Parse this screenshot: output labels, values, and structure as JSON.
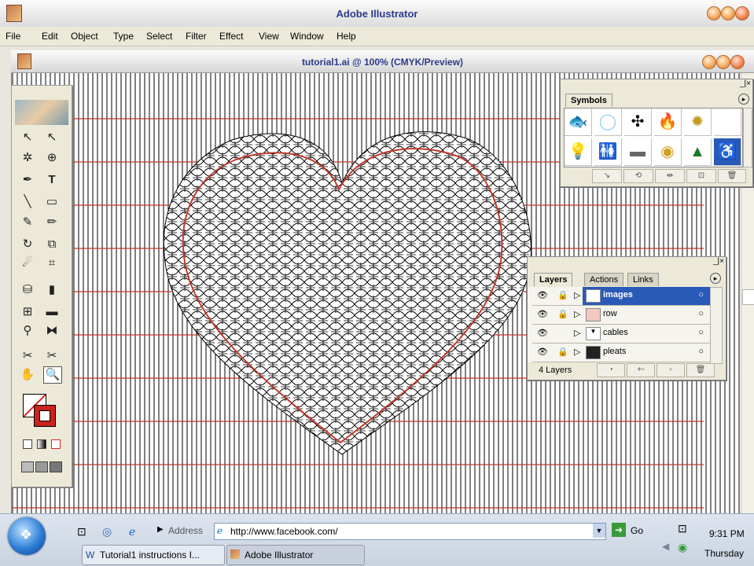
{
  "app": {
    "title": "Adobe Illustrator"
  },
  "menu": [
    "File",
    "Edit",
    "Object",
    "Type",
    "Select",
    "Filter",
    "Effect",
    "View",
    "Window",
    "Help"
  ],
  "document": {
    "title": "tutorial1.ai @ 100% (CMYK/Preview)"
  },
  "symbols_panel": {
    "tab": "Symbols",
    "symbols": [
      "fish",
      "bubble",
      "grime",
      "fire",
      "gear",
      "blank",
      "lightbulb",
      "restrooms",
      "puddle",
      "lantern",
      "tree",
      "wheelchair"
    ]
  },
  "layers_panel": {
    "tabs": [
      "Layers",
      "Actions",
      "Links"
    ],
    "layers": [
      {
        "name": "images",
        "selected": true
      },
      {
        "name": "row",
        "selected": false
      },
      {
        "name": "cables",
        "selected": false
      },
      {
        "name": "pleats",
        "selected": false
      }
    ],
    "count_label": "4 Layers"
  },
  "taskbar": {
    "address_label": "Address",
    "address_value": "http://www.facebook.com/",
    "go_label": "Go",
    "time": "9:31 PM",
    "day": "Thursday",
    "tasks": [
      "Tutorial1 instructions I...",
      "Adobe Illustrator"
    ]
  },
  "colors": {
    "guide": "#c0392b",
    "heart": "#c0392b",
    "selection": "#2a5ab8"
  }
}
